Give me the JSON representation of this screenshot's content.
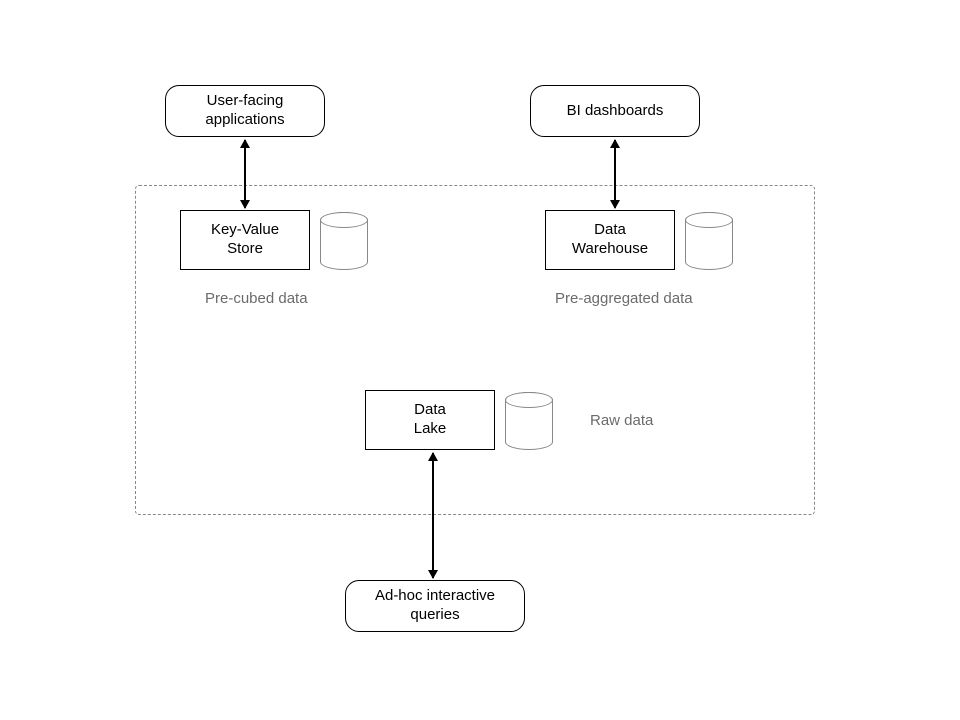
{
  "nodes": {
    "user_apps": {
      "line1": "User-facing",
      "line2": "applications"
    },
    "bi_dashboards": "BI dashboards",
    "kv_store": {
      "line1": "Key-Value",
      "line2": "Store"
    },
    "data_warehouse": {
      "line1": "Data",
      "line2": "Warehouse"
    },
    "data_lake": {
      "line1": "Data",
      "line2": "Lake"
    },
    "adhoc": {
      "line1": "Ad-hoc interactive",
      "line2": "queries"
    }
  },
  "captions": {
    "precubed": "Pre-cubed data",
    "preagg": "Pre-aggregated data",
    "raw": "Raw data"
  },
  "colors": {
    "border": "#000000",
    "dashed": "#888888",
    "caption": "#6b6b6b",
    "background": "#ffffff"
  }
}
